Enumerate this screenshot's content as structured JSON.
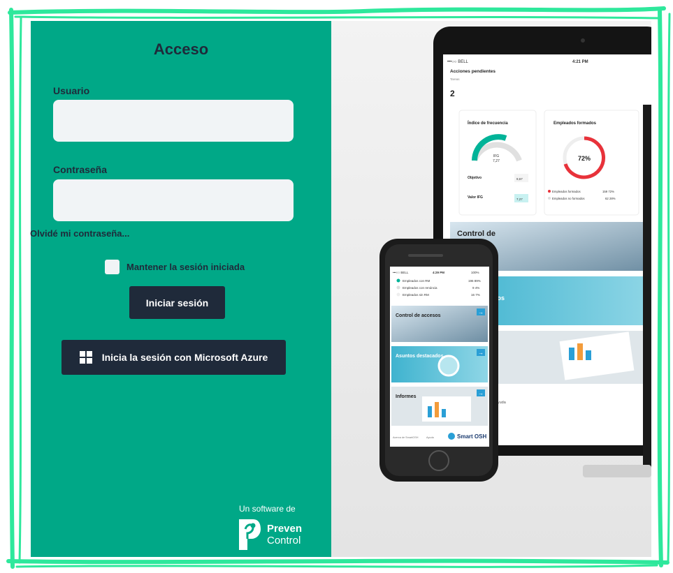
{
  "login": {
    "title": "Acceso",
    "username_label": "Usuario",
    "username_value": "",
    "password_label": "Contraseña",
    "password_value": "",
    "forgot_password": "Olvidé mi contraseña...",
    "keep_session_label": "Mantener la sesión iniciada",
    "keep_session_checked": false,
    "login_button": "Iniciar sesión",
    "azure_button": "Inicia la sesión con Microsoft Azure"
  },
  "branding": {
    "software_by": "Un software de",
    "logo_word1": "Preven",
    "logo_word2": "Control"
  },
  "tablet": {
    "carrier": "•••○○ BELL",
    "time": "4:21 PM",
    "pending_title": "Acciones pendientes",
    "pending_sub": "Tareas",
    "pending_value": "2",
    "freq_title": "Índice de frecuencia",
    "ifg_label": "IFG",
    "ifg_value": "7,27",
    "objetivo_label": "Objetivo",
    "objetivo_value": "9,67",
    "valor_label": "Valor IFG",
    "valor_value": "7,27",
    "trained_title": "Empleados formados",
    "trained_pct": "72%",
    "trained_row1": "Empleados formados",
    "trained_row1_vals": "159  72%",
    "trained_row2": "Empleados no formados",
    "trained_row2_vals": "62  28%",
    "tile_control": "Control de",
    "tile_control2": "accesos",
    "tile_asuntos": "dos",
    "footer_ayuda": "n  Ayuda"
  },
  "phone": {
    "carrier": "•••○○ BELL",
    "time": "4:29 PM",
    "battery": "100%",
    "rows": [
      {
        "label": "Empleados con RM",
        "vals": "196  89%"
      },
      {
        "label": "Empleados con renúncia",
        "vals": "9  4%"
      },
      {
        "label": "Empleados sin RM",
        "vals": "16  7%"
      }
    ],
    "tile1": "Control de accesos",
    "tile2": "Asuntos destacados",
    "tile3": "Informes",
    "footer_left": "Acerca de SmartOSH",
    "footer_mid": "Ayuda",
    "brand": "Smart OSH"
  },
  "colors": {
    "panel": "#00a887",
    "dark": "#1f2a3a",
    "input": "#f1f4f6",
    "frame": "#2ee89c"
  }
}
